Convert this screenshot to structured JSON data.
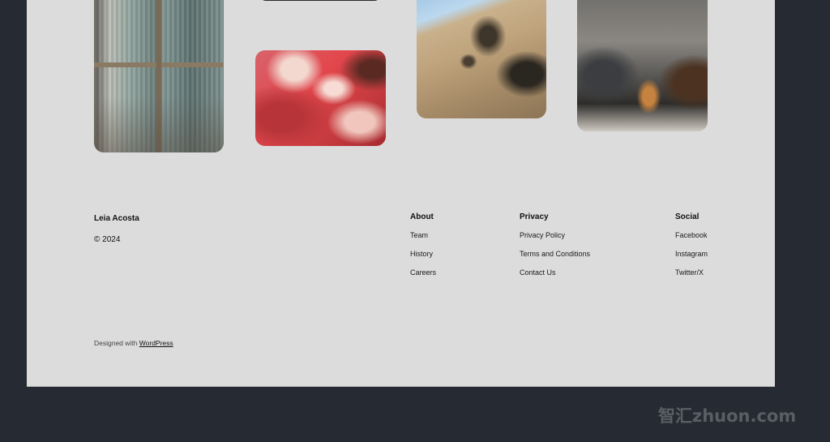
{
  "gallery": {
    "images": [
      {
        "name": "window-curtains-photo",
        "alt": "Window with sheer curtains"
      },
      {
        "name": "pink-flower-photo",
        "alt": "Close-up of pink flower petals"
      },
      {
        "name": "building-facade-photo",
        "alt": "Wavy stone building facade against sky"
      },
      {
        "name": "cafe-chairs-photo",
        "alt": "Cafe table with wooden chairs"
      }
    ]
  },
  "footer": {
    "site_name": "Leia Acosta",
    "copyright": "© 2024",
    "columns": [
      {
        "heading": "About",
        "links": [
          "Team",
          "History",
          "Careers"
        ]
      },
      {
        "heading": "Privacy",
        "links": [
          "Privacy Policy",
          "Terms and Conditions",
          "Contact Us"
        ]
      },
      {
        "heading": "Social",
        "links": [
          "Facebook",
          "Instagram",
          "Twitter/X"
        ]
      }
    ],
    "credit_prefix": "Designed with ",
    "credit_link": "WordPress"
  },
  "watermark": "智汇zhuon.com",
  "colors": {
    "page_background": "#252a33",
    "panel_background": "#dcdcdc",
    "text": "#111111"
  }
}
